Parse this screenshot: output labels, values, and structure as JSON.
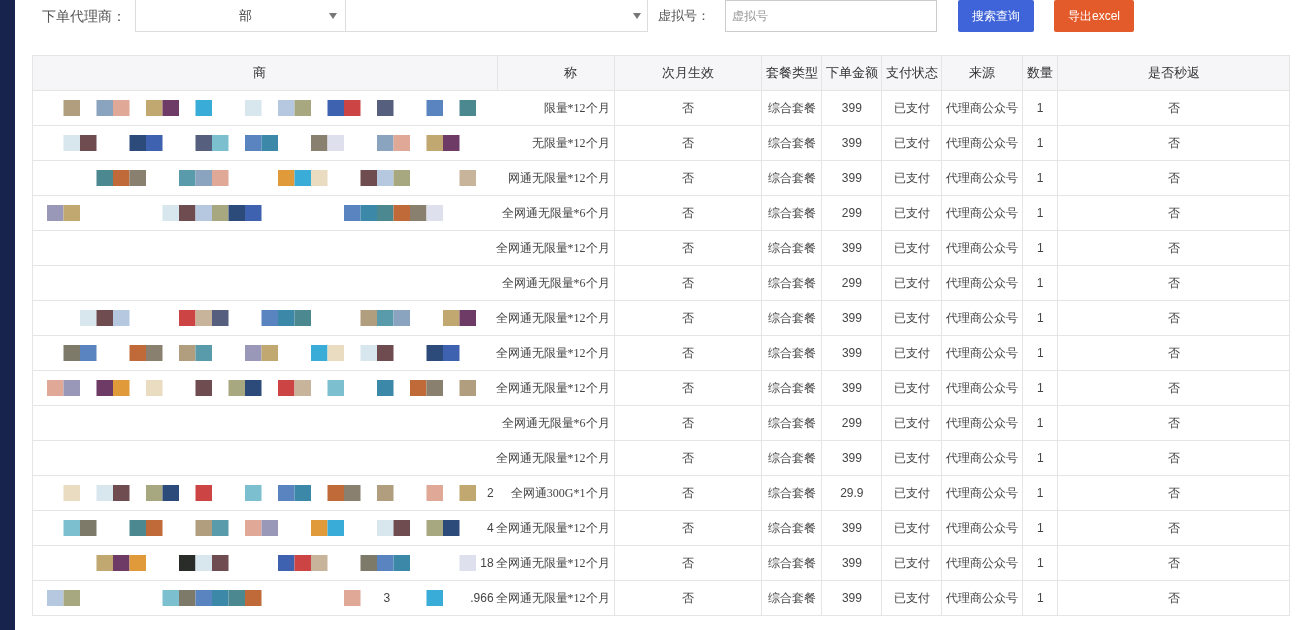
{
  "filters": {
    "agent_label": "下单代理商：",
    "agent_select": {
      "value": "部"
    },
    "virtual_label": "虚拟号：",
    "virtual_input": {
      "placeholder": "虚拟号"
    }
  },
  "buttons": [
    {
      "label": "搜索查询",
      "kind": "primary"
    },
    {
      "label": "导出excel",
      "kind": "export"
    }
  ],
  "table": {
    "columns": [
      "商",
      "称",
      "次月生效",
      "套餐类型",
      "下单金额",
      "支付状态",
      "来源",
      "数量",
      "是否秒返"
    ],
    "rows": [
      {
        "cells": [
          "",
          "限量*12个月",
          "否",
          "综合套餐",
          "399",
          "已支付",
          "代理商公众号",
          "1",
          "否"
        ]
      },
      {
        "cells": [
          "",
          "无限量*12个月",
          "否",
          "综合套餐",
          "399",
          "已支付",
          "代理商公众号",
          "1",
          "否"
        ]
      },
      {
        "cells": [
          "",
          "网通无限量*12个月",
          "否",
          "综合套餐",
          "399",
          "已支付",
          "代理商公众号",
          "1",
          "否"
        ]
      },
      {
        "cells": [
          "",
          "全网通无限量*6个月",
          "否",
          "综合套餐",
          "299",
          "已支付",
          "代理商公众号",
          "1",
          "否"
        ]
      },
      {
        "cells": [
          "",
          "全网通无限量*12个月",
          "否",
          "综合套餐",
          "399",
          "已支付",
          "代理商公众号",
          "1",
          "否"
        ]
      },
      {
        "cells": [
          "",
          "全网通无限量*6个月",
          "否",
          "综合套餐",
          "299",
          "已支付",
          "代理商公众号",
          "1",
          "否"
        ]
      },
      {
        "cells": [
          "",
          "全网通无限量*12个月",
          "否",
          "综合套餐",
          "399",
          "已支付",
          "代理商公众号",
          "1",
          "否"
        ]
      },
      {
        "cells": [
          "",
          "全网通无限量*12个月",
          "否",
          "综合套餐",
          "399",
          "已支付",
          "代理商公众号",
          "1",
          "否"
        ]
      },
      {
        "cells": [
          "",
          "全网通无限量*12个月",
          "否",
          "综合套餐",
          "399",
          "已支付",
          "代理商公众号",
          "1",
          "否"
        ]
      },
      {
        "cells": [
          "",
          "全网通无限量*6个月",
          "否",
          "综合套餐",
          "299",
          "已支付",
          "代理商公众号",
          "1",
          "否"
        ]
      },
      {
        "cells": [
          "",
          "全网通无限量*12个月",
          "否",
          "综合套餐",
          "399",
          "已支付",
          "代理商公众号",
          "1",
          "否"
        ]
      },
      {
        "cells": [
          "2",
          "全网通300G*1个月",
          "否",
          "综合套餐",
          "29.9",
          "已支付",
          "代理商公众号",
          "1",
          "否"
        ]
      },
      {
        "cells": [
          "4",
          "全网通无限量*12个月",
          "否",
          "综合套餐",
          "399",
          "已支付",
          "代理商公众号",
          "1",
          "否"
        ]
      },
      {
        "cells": [
          "18",
          "全网通无限量*12个月",
          "否",
          "综合套餐",
          "399",
          "已支付",
          "代理商公众号",
          "1",
          "否"
        ]
      },
      {
        "fragment": "3",
        "cells": [
          ".966",
          "全网通无限量*12个月",
          "否",
          "综合套餐",
          "399",
          "已支付",
          "代理商公众号",
          "1",
          "否"
        ]
      }
    ]
  }
}
